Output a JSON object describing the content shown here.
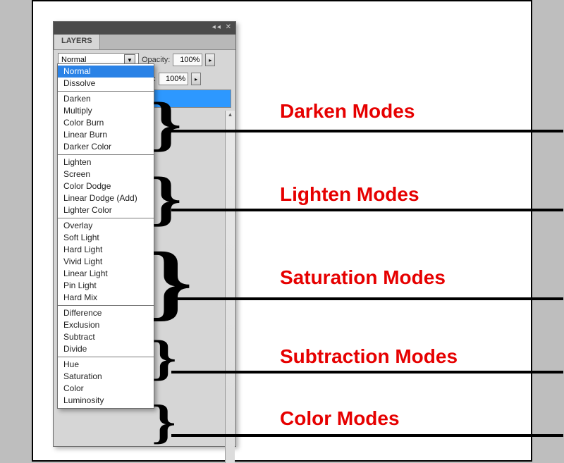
{
  "panel": {
    "title": "LAYERS",
    "blendSelected": "Normal",
    "opacityLabel": "Opacity:",
    "opacityValue": "100%",
    "fillLabel": "Fill:",
    "fillValue": "100%"
  },
  "dropdown": {
    "groups": [
      {
        "items": [
          {
            "label": "Normal",
            "selected": true
          },
          {
            "label": "Dissolve"
          }
        ]
      },
      {
        "items": [
          {
            "label": "Darken"
          },
          {
            "label": "Multiply"
          },
          {
            "label": "Color Burn"
          },
          {
            "label": "Linear Burn"
          },
          {
            "label": "Darker Color"
          }
        ]
      },
      {
        "items": [
          {
            "label": "Lighten"
          },
          {
            "label": "Screen"
          },
          {
            "label": "Color Dodge"
          },
          {
            "label": "Linear Dodge (Add)"
          },
          {
            "label": "Lighter Color"
          }
        ]
      },
      {
        "items": [
          {
            "label": "Overlay"
          },
          {
            "label": "Soft Light"
          },
          {
            "label": "Hard Light"
          },
          {
            "label": "Vivid Light"
          },
          {
            "label": "Linear Light"
          },
          {
            "label": "Pin Light"
          },
          {
            "label": "Hard Mix"
          }
        ]
      },
      {
        "items": [
          {
            "label": "Difference"
          },
          {
            "label": "Exclusion"
          },
          {
            "label": "Subtract"
          },
          {
            "label": "Divide"
          }
        ]
      },
      {
        "items": [
          {
            "label": "Hue"
          },
          {
            "label": "Saturation"
          },
          {
            "label": "Color"
          },
          {
            "label": "Luminosity"
          }
        ]
      }
    ]
  },
  "annotations": [
    {
      "label": "Darken Modes",
      "bracketTop": 140,
      "bracketSize": 86,
      "lineY": 182,
      "labelY": 140
    },
    {
      "label": "Lighten Modes",
      "bracketTop": 246,
      "bracketSize": 86,
      "lineY": 294,
      "labelY": 258
    },
    {
      "label": "Saturation Modes",
      "bracketTop": 348,
      "bracketSize": 120,
      "lineY": 420,
      "labelY": 376
    },
    {
      "label": "Subtraction Modes",
      "bracketTop": 482,
      "bracketSize": 70,
      "lineY": 524,
      "labelY": 488
    },
    {
      "label": "Color Modes",
      "bracketTop": 572,
      "bracketSize": 68,
      "lineY": 614,
      "labelY": 576
    }
  ]
}
